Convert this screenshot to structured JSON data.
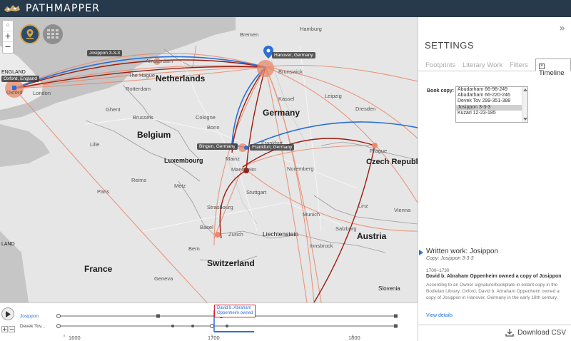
{
  "header": {
    "app_title": "PATHMAPPER"
  },
  "map": {
    "zoom_in": "+",
    "zoom_out": "−",
    "countries": [
      "Netherlands",
      "Germany",
      "Belgium",
      "Luxembourg",
      "France",
      "Switzerland",
      "Austria",
      "Czech Republic",
      "Liechtenstein",
      "Slovenia",
      "ENGLAND",
      "LAND"
    ],
    "cities": [
      "Bremen",
      "Hamburg",
      "Amsterdam",
      "The Hague",
      "Rotterdam",
      "Brunswick",
      "Kassel",
      "Leipzig",
      "Dresden",
      "Cologne",
      "Brussels",
      "Ghent",
      "London",
      "Bonn",
      "Nuremberg",
      "Stuttgart",
      "Munich",
      "Zurich",
      "Bern",
      "Strasbourg",
      "Frankfurt",
      "Mainz",
      "Mannheim",
      "Prague",
      "Vienna",
      "Paris",
      "Metz",
      "Reims",
      "Lille",
      "Oxford",
      "Salzburg",
      "Innsbruck",
      "Linz",
      "Basel",
      "Geneva"
    ],
    "place_tags": {
      "hanover": "Hanover, Germany",
      "oxford": "Oxford, England",
      "josippon": "Josippon 3-3-3",
      "bingen": "Bingen, Germany",
      "frankfurt": "Frankfurt, Germany"
    },
    "colors": {
      "blue_route": "#2a6fd6",
      "dark_route": "#9b1c12",
      "light_route": "#e8876a",
      "node": "#e88a6a"
    }
  },
  "timeline": {
    "rows": [
      {
        "label": "Josippon"
      },
      {
        "label": "Devek Tov..."
      }
    ],
    "ticks": [
      "1600",
      "1700",
      "1800"
    ],
    "tooltip_line1": "David b. Abraham",
    "tooltip_line2": "Oppenheim owned",
    "play_icon": "play-icon",
    "plus": "+",
    "minus": "−"
  },
  "panel": {
    "title": "SETTINGS",
    "collapse": "»",
    "tabs": [
      "Footprints",
      "Literary Work",
      "Filters"
    ],
    "active_tab": "Timeline",
    "book_copy_label": "Book copy:",
    "book_copies": [
      "Abudarham 66-98-249",
      "Abudarham 66-220-246",
      "Devek Tov 299-351-388",
      "Josippon 3-3-3",
      "Kuzari 12-23-185"
    ],
    "selected_copy_index": 3,
    "written_work": "Written work: Josippon",
    "copy_line": "Copy: Josippon 3-3-3",
    "event_date": "1700–1730",
    "event_title": "David b. Abraham Oppenheim owned a copy of Josippon",
    "event_desc": "According to an Owner signature/bookplate in extant copy in the Bodleian Library, Oxford, David b. Abraham Oppenheim owned a copy of Josippon in Hanover, Germany in the early 18th century.",
    "view_details": "View details",
    "download": "Download CSV"
  }
}
